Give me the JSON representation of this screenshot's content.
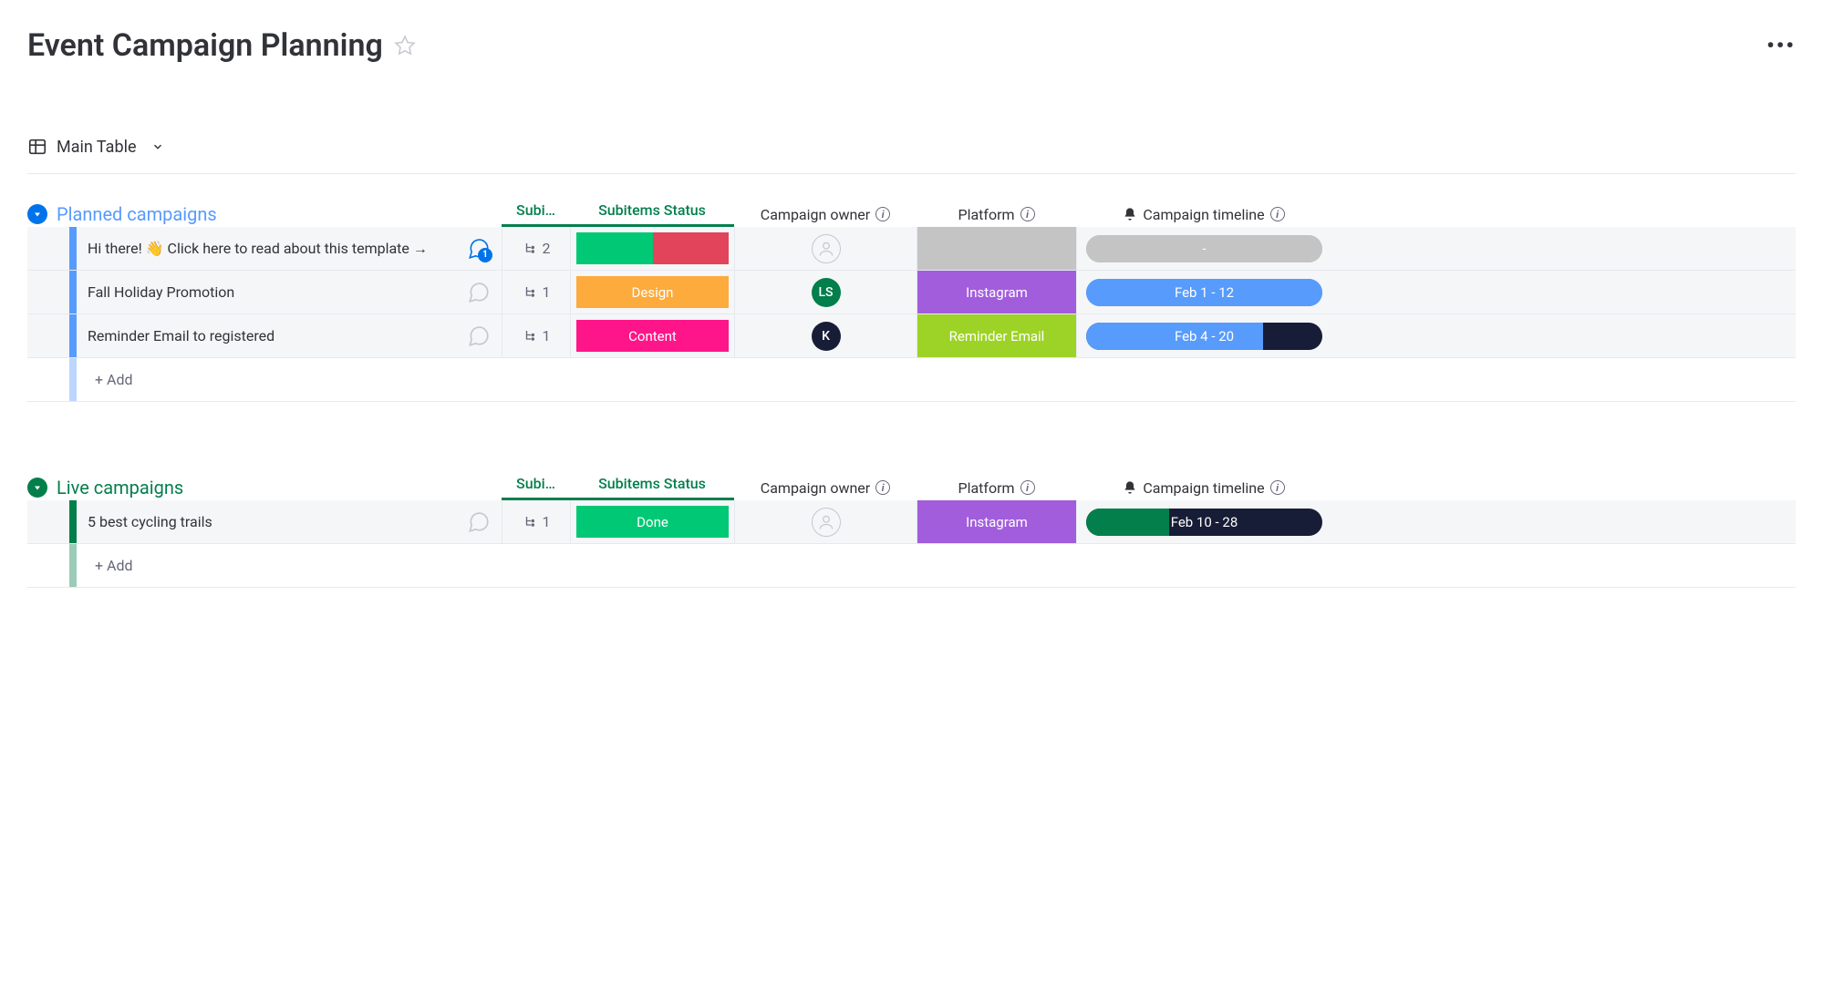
{
  "header": {
    "title": "Event Campaign Planning"
  },
  "view": {
    "name": "Main Table"
  },
  "columns": {
    "subitems": "Subi…",
    "status": "Subitems Status",
    "owner": "Campaign owner",
    "platform": "Platform",
    "timeline": "Campaign timeline"
  },
  "groups": [
    {
      "name": "Planned campaigns",
      "color": "#579bfc",
      "collapse_color": "#0073ea",
      "rows": [
        {
          "name": "Hi there! 👋 Click here to read about this template →",
          "chat_badge": "1",
          "chat_color": "#0073ea",
          "subitems_count": "2",
          "status": {
            "type": "split",
            "colors": [
              "#00c875",
              "#e2445c"
            ]
          },
          "owner": {
            "type": "empty"
          },
          "platform": {
            "label": "",
            "color": "#c4c4c4"
          },
          "timeline": {
            "label": "-",
            "bg": "#c4c4c4",
            "fill_color": "#c4c4c4",
            "fill_pct": 100
          }
        },
        {
          "name": "Fall Holiday Promotion",
          "subitems_count": "1",
          "status": {
            "type": "single",
            "label": "Design",
            "color": "#fdab3d"
          },
          "owner": {
            "type": "initials",
            "text": "LS",
            "color": "#037f4c"
          },
          "platform": {
            "label": "Instagram",
            "color": "#a25ddc"
          },
          "timeline": {
            "label": "Feb 1 - 12",
            "bg": "#579bfc",
            "fill_color": "#579bfc",
            "fill_pct": 100
          }
        },
        {
          "name": "Reminder Email to registered",
          "subitems_count": "1",
          "status": {
            "type": "single",
            "label": "Content",
            "color": "#ff158a"
          },
          "owner": {
            "type": "initials",
            "text": "K",
            "color": "#181d37"
          },
          "platform": {
            "label": "Reminder Email",
            "color": "#9cd326"
          },
          "timeline": {
            "label": "Feb 4 - 20",
            "bg": "#181d37",
            "fill_color": "#579bfc",
            "fill_pct": 75
          }
        }
      ],
      "add_label": "+ Add"
    },
    {
      "name": "Live campaigns",
      "color": "#037f4c",
      "collapse_color": "#037f4c",
      "rows": [
        {
          "name": "5 best cycling trails",
          "subitems_count": "1",
          "status": {
            "type": "single",
            "label": "Done",
            "color": "#00c875"
          },
          "owner": {
            "type": "empty"
          },
          "platform": {
            "label": "Instagram",
            "color": "#a25ddc"
          },
          "timeline": {
            "label": "Feb 10 - 28",
            "bg": "#181d37",
            "fill_color": "#037f4c",
            "fill_pct": 35
          }
        }
      ],
      "add_label": "+ Add"
    }
  ]
}
